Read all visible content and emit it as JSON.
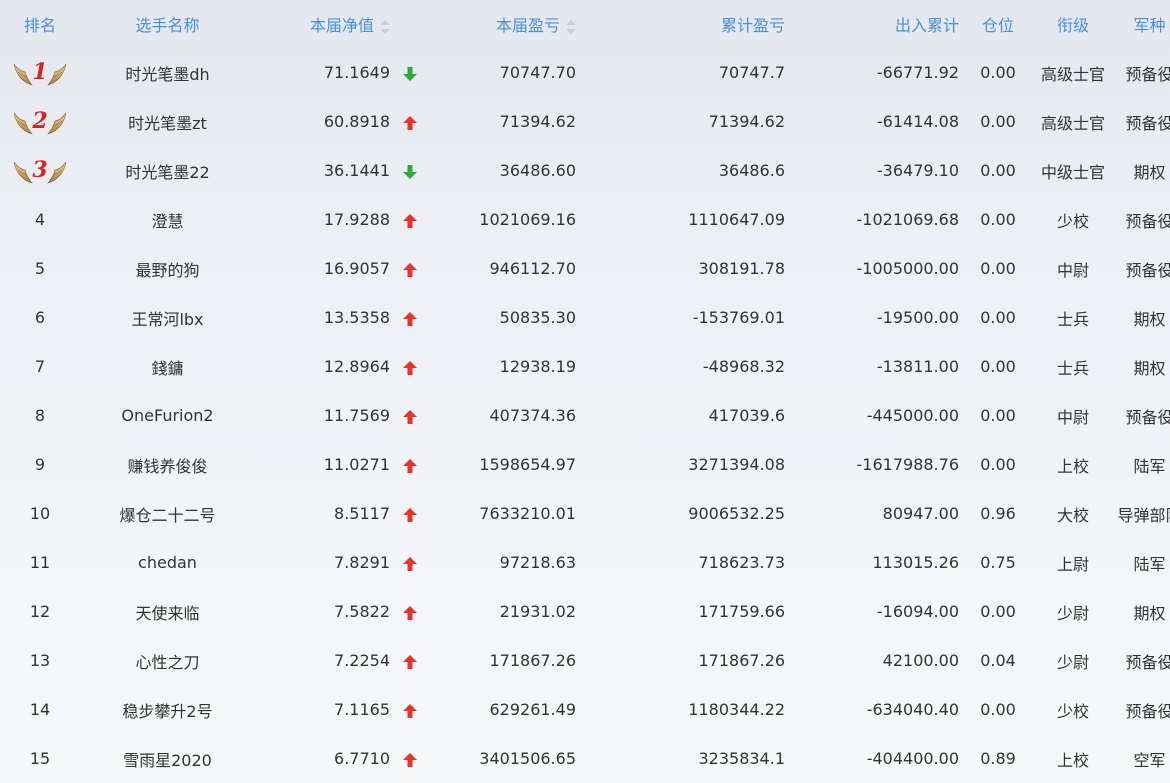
{
  "header": {
    "rank": "排名",
    "name": "选手名称",
    "nav": "本届净值",
    "pnl": "本届盈亏",
    "cum_pnl": "累计盈亏",
    "flow": "出入累计",
    "position": "仓位",
    "grade": "衔级",
    "army": "军种"
  },
  "colors": {
    "header_text": "#4a90d9",
    "arrow_up": "#e8322a",
    "arrow_down": "#2eaa3b",
    "medal_number": "#e0201f"
  },
  "rows": [
    {
      "rank": "1",
      "medal": true,
      "name": "时光笔墨dh",
      "nav": "71.1649",
      "trend": "down",
      "pnl": "70747.70",
      "cum_pnl": "70747.7",
      "flow": "-66771.92",
      "position": "0.00",
      "grade": "高级士官",
      "army": "预备役"
    },
    {
      "rank": "2",
      "medal": true,
      "name": "时光笔墨zt",
      "nav": "60.8918",
      "trend": "up",
      "pnl": "71394.62",
      "cum_pnl": "71394.62",
      "flow": "-61414.08",
      "position": "0.00",
      "grade": "高级士官",
      "army": "预备役"
    },
    {
      "rank": "3",
      "medal": true,
      "name": "时光笔墨22",
      "nav": "36.1441",
      "trend": "down",
      "pnl": "36486.60",
      "cum_pnl": "36486.6",
      "flow": "-36479.10",
      "position": "0.00",
      "grade": "中级士官",
      "army": "期权"
    },
    {
      "rank": "4",
      "medal": false,
      "name": "澄慧",
      "nav": "17.9288",
      "trend": "up",
      "pnl": "1021069.16",
      "cum_pnl": "1110647.09",
      "flow": "-1021069.68",
      "position": "0.00",
      "grade": "少校",
      "army": "预备役"
    },
    {
      "rank": "5",
      "medal": false,
      "name": "最野的狗",
      "nav": "16.9057",
      "trend": "up",
      "pnl": "946112.70",
      "cum_pnl": "308191.78",
      "flow": "-1005000.00",
      "position": "0.00",
      "grade": "中尉",
      "army": "预备役"
    },
    {
      "rank": "6",
      "medal": false,
      "name": "王常河lbx",
      "nav": "13.5358",
      "trend": "up",
      "pnl": "50835.30",
      "cum_pnl": "-153769.01",
      "flow": "-19500.00",
      "position": "0.00",
      "grade": "士兵",
      "army": "期权"
    },
    {
      "rank": "7",
      "medal": false,
      "name": "錢鏞",
      "nav": "12.8964",
      "trend": "up",
      "pnl": "12938.19",
      "cum_pnl": "-48968.32",
      "flow": "-13811.00",
      "position": "0.00",
      "grade": "士兵",
      "army": "期权"
    },
    {
      "rank": "8",
      "medal": false,
      "name": "OneFurion2",
      "nav": "11.7569",
      "trend": "up",
      "pnl": "407374.36",
      "cum_pnl": "417039.6",
      "flow": "-445000.00",
      "position": "0.00",
      "grade": "中尉",
      "army": "预备役"
    },
    {
      "rank": "9",
      "medal": false,
      "name": "赚钱养俊俊",
      "nav": "11.0271",
      "trend": "up",
      "pnl": "1598654.97",
      "cum_pnl": "3271394.08",
      "flow": "-1617988.76",
      "position": "0.00",
      "grade": "上校",
      "army": "陆军"
    },
    {
      "rank": "10",
      "medal": false,
      "name": "爆仓二十二号",
      "nav": "8.5117",
      "trend": "up",
      "pnl": "7633210.01",
      "cum_pnl": "9006532.25",
      "flow": "80947.00",
      "position": "0.96",
      "grade": "大校",
      "army": "导弹部队"
    },
    {
      "rank": "11",
      "medal": false,
      "name": "chedan",
      "nav": "7.8291",
      "trend": "up",
      "pnl": "97218.63",
      "cum_pnl": "718623.73",
      "flow": "113015.26",
      "position": "0.75",
      "grade": "上尉",
      "army": "陆军"
    },
    {
      "rank": "12",
      "medal": false,
      "name": "天使来临",
      "nav": "7.5822",
      "trend": "up",
      "pnl": "21931.02",
      "cum_pnl": "171759.66",
      "flow": "-16094.00",
      "position": "0.00",
      "grade": "少尉",
      "army": "期权"
    },
    {
      "rank": "13",
      "medal": false,
      "name": "心性之刀",
      "nav": "7.2254",
      "trend": "up",
      "pnl": "171867.26",
      "cum_pnl": "171867.26",
      "flow": "42100.00",
      "position": "0.04",
      "grade": "少尉",
      "army": "预备役"
    },
    {
      "rank": "14",
      "medal": false,
      "name": "稳步攀升2号",
      "nav": "7.1165",
      "trend": "up",
      "pnl": "629261.49",
      "cum_pnl": "1180344.22",
      "flow": "-634040.40",
      "position": "0.00",
      "grade": "少校",
      "army": "预备役"
    },
    {
      "rank": "15",
      "medal": false,
      "name": "雪雨星2020",
      "nav": "6.7710",
      "trend": "up",
      "pnl": "3401506.65",
      "cum_pnl": "3235834.1",
      "flow": "-404400.00",
      "position": "0.89",
      "grade": "上校",
      "army": "空军"
    }
  ]
}
